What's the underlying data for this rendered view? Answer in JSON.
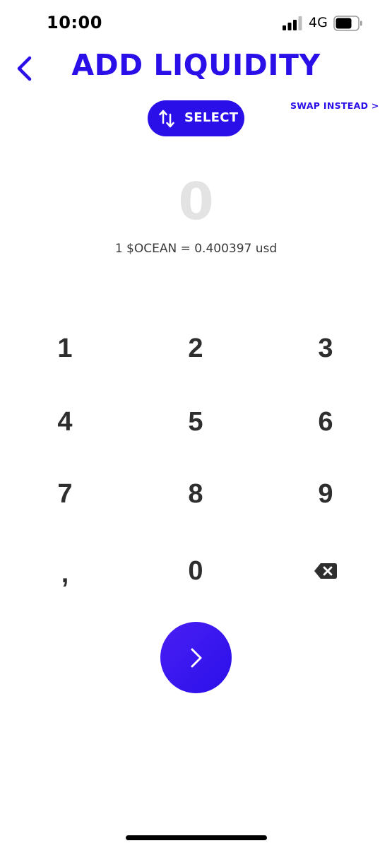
{
  "status_bar": {
    "time": "10:00",
    "network": "4G",
    "signal_icon": "cellular-signal-icon",
    "battery_icon": "battery-icon"
  },
  "header": {
    "back_icon": "chevron-left-icon",
    "title": "ADD LIQUIDITY"
  },
  "select_button": {
    "icon": "swap-vertical-arrows-icon",
    "label": "SELECT"
  },
  "swap_link": {
    "label": "SWAP INSTEAD >"
  },
  "amount": {
    "value": "0",
    "rate_text": "1 $OCEAN = 0.400397 usd"
  },
  "keypad": {
    "keys": [
      "1",
      "2",
      "3",
      "4",
      "5",
      "6",
      "7",
      "8",
      "9",
      ",",
      "0"
    ],
    "backspace_icon": "backspace-icon"
  },
  "next_button": {
    "icon": "chevron-right-icon"
  },
  "colors": {
    "accent": "#2a0fe8",
    "placeholder_amount": "#e3e3e3",
    "key_text": "#2e2e2e"
  }
}
